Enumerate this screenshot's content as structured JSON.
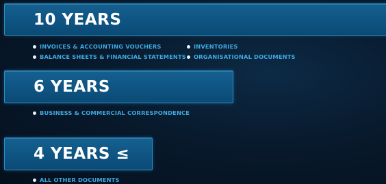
{
  "sections": [
    {
      "title": "10 YEARS",
      "items": [
        "INVOICES & ACCOUNTING VOUCHERS",
        "INVENTORIES",
        "BALANCE SHEETS & FINANCIAL STATEMENTS",
        "ORGANISATIONAL DOCUMENTS"
      ]
    },
    {
      "title": "6 YEARS",
      "items": [
        "BUSINESS & COMMERCIAL CORRESPONDENCE"
      ]
    },
    {
      "title": "4 YEARS ≤",
      "items": [
        "ALL OTHER DOCUMENTS"
      ]
    }
  ],
  "colors": {
    "bar": "#0f5584",
    "item_text": "#3fa9e0",
    "title_text": "#ffffff"
  }
}
